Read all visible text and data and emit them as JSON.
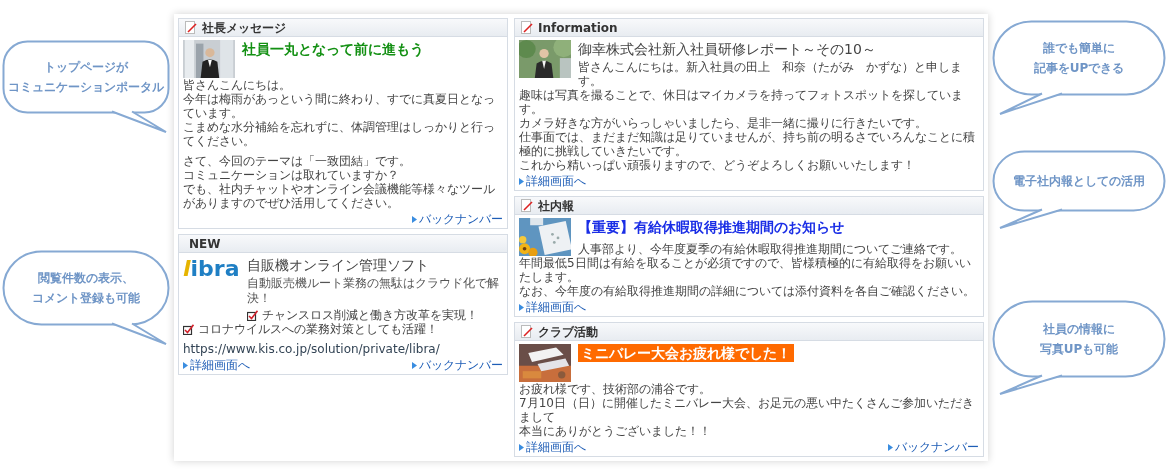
{
  "columns": [
    {
      "panels": [
        {
          "header": "社長メッセージ",
          "header_icon": true,
          "image": {
            "kind": "picture"
          },
          "beside": [
            {
              "kind": "title-green",
              "text": "社員一丸となって前に進もう"
            }
          ],
          "body": [
            {
              "kind": "text",
              "text": "皆さんこんにちは。"
            },
            {
              "kind": "text",
              "text": "今年は梅雨があっという間に終わり、すでに真夏日となっています。"
            },
            {
              "kind": "text",
              "text": "こまめな水分補給を忘れずに、体調管理はしっかりと行ってください。"
            },
            {
              "kind": "gap"
            },
            {
              "kind": "text",
              "text": "さて、今回のテーマは「一致団結」です。"
            },
            {
              "kind": "partial",
              "text": "コミュニケーションは取れていますか？"
            },
            {
              "kind": "partial",
              "text": "でも、社内チャットやオンライン会議機能等様々なツールがありますのでぜひ活用してください。"
            }
          ],
          "links": [
            {
              "kind": "archive",
              "text": "バックナンバー"
            }
          ]
        },
        {
          "header": "NEW",
          "header_icon": false,
          "logo": "libra",
          "beside": [
            {
              "kind": "title-plain",
              "text": "自販機オンライン管理ソフト"
            },
            {
              "kind": "subtitle",
              "text": "自動販売機ルート業務の無駄はクラウド化で解決！"
            },
            {
              "kind": "check",
              "checked": true,
              "text": "チャンスロス削減と働き方改革を実現！"
            }
          ],
          "body": [
            {
              "kind": "check",
              "checked": true,
              "text": "コロナウイルスへの業務対策としても活躍！"
            },
            {
              "kind": "gap"
            },
            {
              "kind": "url",
              "text": "https://www.kis.co.jp/solution/private/libra/"
            }
          ],
          "links": [
            {
              "kind": "detail",
              "text": "詳細画面へ"
            },
            {
              "kind": "archive",
              "text": "バックナンバー"
            }
          ]
        }
      ]
    },
    {
      "panels": [
        {
          "header": "Information",
          "header_icon": true,
          "image": {
            "kind": "picture"
          },
          "beside": [
            {
              "kind": "title-plain",
              "text": "御幸株式会社新入社員研修レポート～その10～"
            },
            {
              "kind": "text",
              "text": "皆さんこんにちは。新入社員の田上　和奈（たがみ　かずな）と申します。"
            }
          ],
          "body": [
            {
              "kind": "text",
              "text": "趣味は写真を撮ることで、休日はマイカメラを持ってフォトスポットを探しています。"
            },
            {
              "kind": "text",
              "text": "カメラ好きな方がいらっしゃいましたら、是非一緒に撮りに行きたいです。"
            },
            {
              "kind": "text",
              "text": "仕事面では、まだまだ知識は足りていませんが、持ち前の明るさでいろんなことに積極的に挑戦していきたいです。"
            },
            {
              "kind": "text",
              "text": "これから精いっぱい頑張りますので、どうぞよろしくお願いいたします！"
            }
          ],
          "links": [
            {
              "kind": "detail",
              "text": "詳細画面へ"
            }
          ]
        },
        {
          "header": "社内報",
          "header_icon": true,
          "image": {
            "kind": "picture"
          },
          "beside": [
            {
              "kind": "title-blue",
              "text": "【重要】有給休暇取得推進期間のお知らせ"
            },
            {
              "kind": "text",
              "text": "人事部より、今年度夏季の有給休暇取得推進期間についてご連絡です。"
            }
          ],
          "body": [
            {
              "kind": "text",
              "text": "年間最低5日間は有給を取ることが必須ですので、皆様積極的に有給取得をお願いいたします。"
            },
            {
              "kind": "text",
              "text": "なお、今年度の有給取得推進期間の詳細については添付資料を各自ご確認ください。"
            }
          ],
          "links": [
            {
              "kind": "detail",
              "text": "詳細画面へ"
            }
          ]
        },
        {
          "header": "クラブ活動",
          "header_icon": true,
          "image": {
            "kind": "picture"
          },
          "beside": [
            {
              "kind": "title-banner",
              "text": "ミニバレー大会お疲れ様でした！"
            }
          ],
          "body": [
            {
              "kind": "text",
              "text": "お疲れ様です、技術部の浦谷です。"
            },
            {
              "kind": "text",
              "text": "7月10日（日）に開催したミニバレー大会、お足元の悪い中たくさんご参加いただきまして"
            },
            {
              "kind": "text",
              "text": "本当にありがとうございました！！"
            }
          ],
          "links": [
            {
              "kind": "detail",
              "text": "詳細画面へ"
            },
            {
              "kind": "archive",
              "text": "バックナンバー"
            }
          ]
        }
      ]
    }
  ],
  "callouts": [
    {
      "lines": [
        "トップページが",
        "コミュニケーションポータル"
      ]
    },
    {
      "lines": [
        "誰でも簡単に",
        "記事をUPできる"
      ]
    },
    {
      "lines": [
        "電子社内報としての活用"
      ]
    },
    {
      "lines": [
        "閲覧件数の表示、",
        "コメント登録も可能"
      ]
    },
    {
      "lines": [
        "社員の情報に",
        "写真UPも可能"
      ]
    }
  ]
}
